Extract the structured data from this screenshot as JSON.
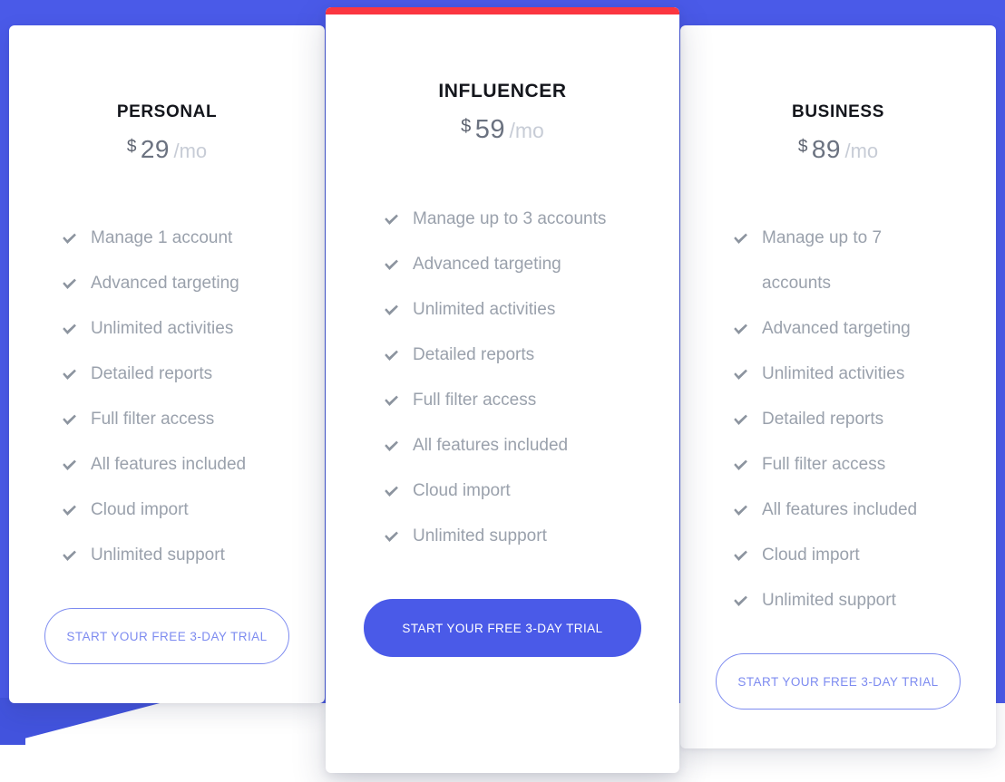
{
  "theme": {
    "background_blue": "#4a5ae8",
    "wedge_blue": "#4253dd",
    "accent_red": "#fb3640",
    "card_white": "#ffffff",
    "feature_text_gray": "#9aa1ac",
    "check_gray": "#8c949f",
    "price_gray": "#6b7280",
    "period_gray": "#c7ccd6",
    "button_outline_blue": "#7d8bf0",
    "plan_title_dark": "#14161c"
  },
  "currency_symbol": "$",
  "period_label": "/mo",
  "cta_label": "START YOUR FREE 3-DAY TRIAL",
  "plans": [
    {
      "id": "personal",
      "name": "PERSONAL",
      "price": "29",
      "currency": "$",
      "period": "/mo",
      "featured": false,
      "cta_label": "START YOUR FREE 3-DAY TRIAL",
      "cta_style": "outline",
      "features": [
        "Manage 1 account",
        "Advanced targeting",
        "Unlimited activities",
        "Detailed reports",
        "Full filter access",
        "All features included",
        "Cloud import",
        "Unlimited support"
      ]
    },
    {
      "id": "influencer",
      "name": "INFLUENCER",
      "price": "59",
      "currency": "$",
      "period": "/mo",
      "featured": true,
      "cta_label": "START YOUR FREE 3-DAY TRIAL",
      "cta_style": "filled",
      "features": [
        "Manage up to 3 accounts",
        "Advanced targeting",
        "Unlimited activities",
        "Detailed reports",
        "Full filter access",
        "All features included",
        "Cloud import",
        "Unlimited support"
      ]
    },
    {
      "id": "business",
      "name": "BUSINESS",
      "price": "89",
      "currency": "$",
      "period": "/mo",
      "featured": false,
      "cta_label": "START YOUR FREE 3-DAY TRIAL",
      "cta_style": "outline",
      "features": [
        "Manage up to 7 accounts",
        "Advanced targeting",
        "Unlimited activities",
        "Detailed reports",
        "Full filter access",
        "All features included",
        "Cloud import",
        "Unlimited support"
      ]
    }
  ],
  "icons": {
    "check": "check-icon"
  }
}
